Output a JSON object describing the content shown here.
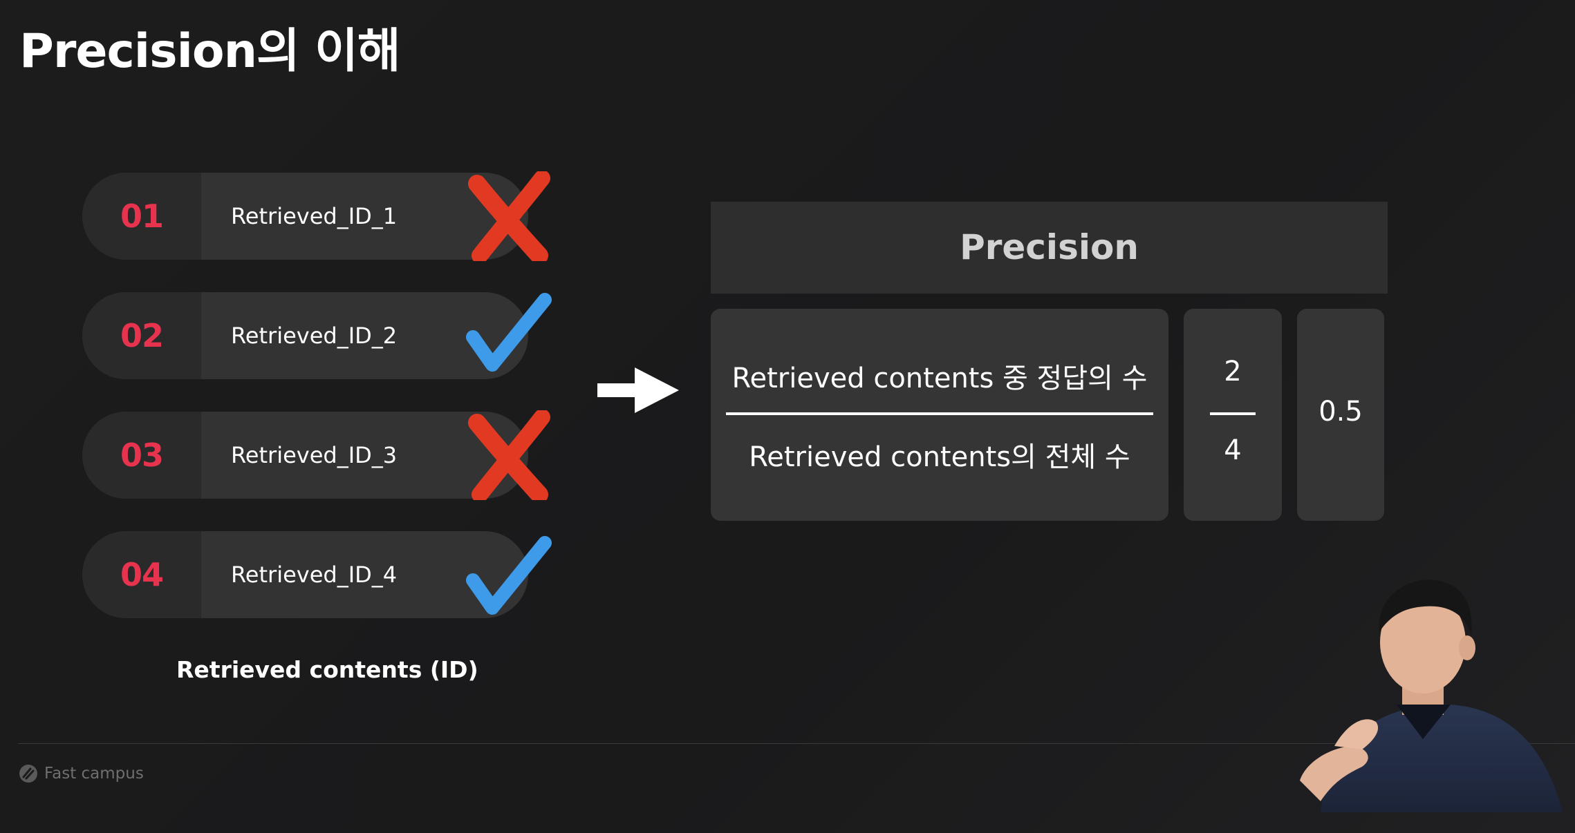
{
  "title": "Precision의 이해",
  "retrieved_items": [
    {
      "number": "01",
      "label": "Retrieved_ID_1",
      "mark": "red-x-icon"
    },
    {
      "number": "02",
      "label": "Retrieved_ID_2",
      "mark": "blue-check-icon"
    },
    {
      "number": "03",
      "label": "Retrieved_ID_3",
      "mark": "red-x-icon"
    },
    {
      "number": "04",
      "label": "Retrieved_ID_4",
      "mark": "blue-check-icon"
    }
  ],
  "caption": "Retrieved contents (ID)",
  "precision": {
    "header": "Precision",
    "numerator_label": "Retrieved contents 중 정답의 수",
    "denominator_label": "Retrieved contents의 전체 수",
    "numerator_value": "2",
    "denominator_value": "4",
    "result": "0.5"
  },
  "brand": "Fast campus",
  "colors": {
    "background": "#1b1b1c",
    "number_red": "#e8334f",
    "x_red": "#e23a22",
    "check_blue": "#3d9be9"
  }
}
